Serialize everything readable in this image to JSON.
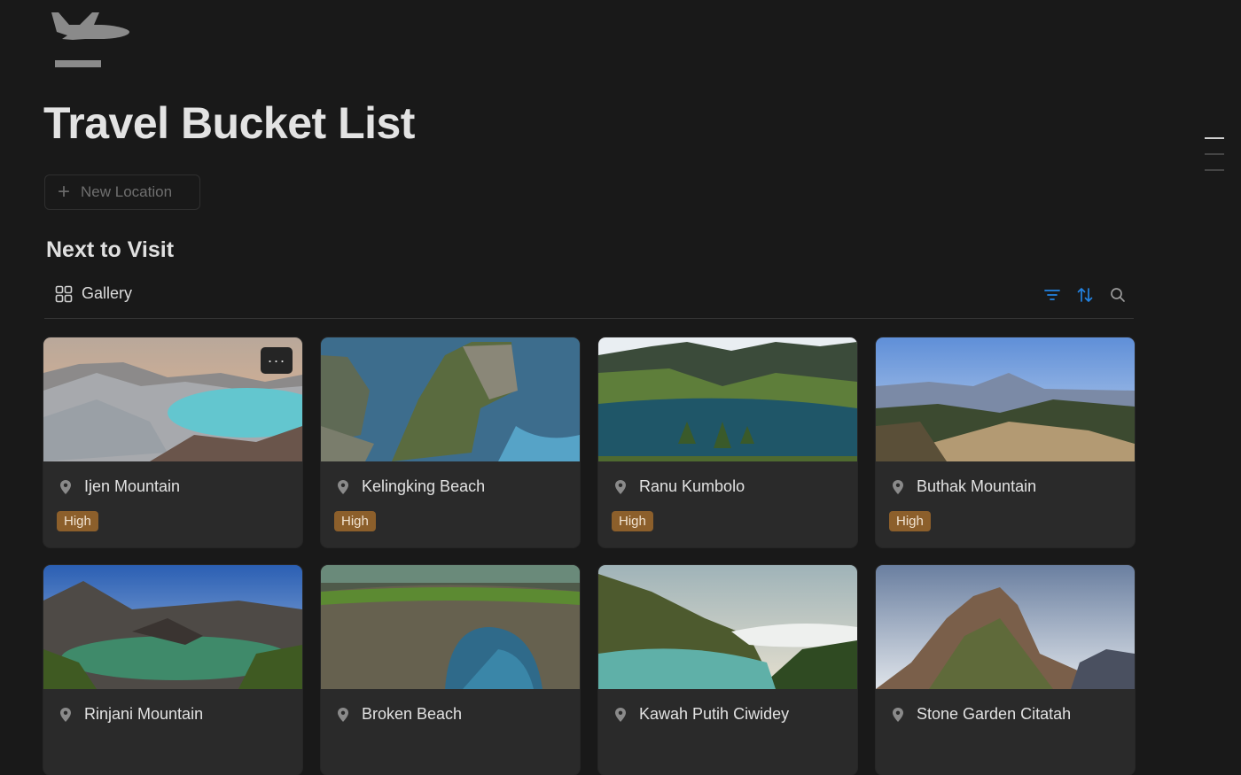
{
  "page": {
    "icon": "airplane-departure-icon",
    "title": "Travel Bucket List",
    "new_button_label": "New Location",
    "section_title": "Next to Visit"
  },
  "view": {
    "tab_label": "Gallery",
    "tab_icon": "gallery-grid-icon",
    "tools": [
      "filter-icon",
      "sort-icon",
      "search-icon"
    ],
    "accent_color": "#2383e2"
  },
  "cards": [
    {
      "name": "Ijen Mountain",
      "priority": "High"
    },
    {
      "name": "Kelingking Beach",
      "priority": "High"
    },
    {
      "name": "Ranu Kumbolo",
      "priority": "High"
    },
    {
      "name": "Buthak Mountain",
      "priority": "High"
    },
    {
      "name": "Rinjani Mountain"
    },
    {
      "name": "Broken Beach"
    },
    {
      "name": "Kawah Putih Ciwidey"
    },
    {
      "name": "Stone Garden Citatah"
    }
  ],
  "colors": {
    "background": "#191919",
    "card": "#2a2a2a",
    "badge": "#8c5f2b"
  }
}
